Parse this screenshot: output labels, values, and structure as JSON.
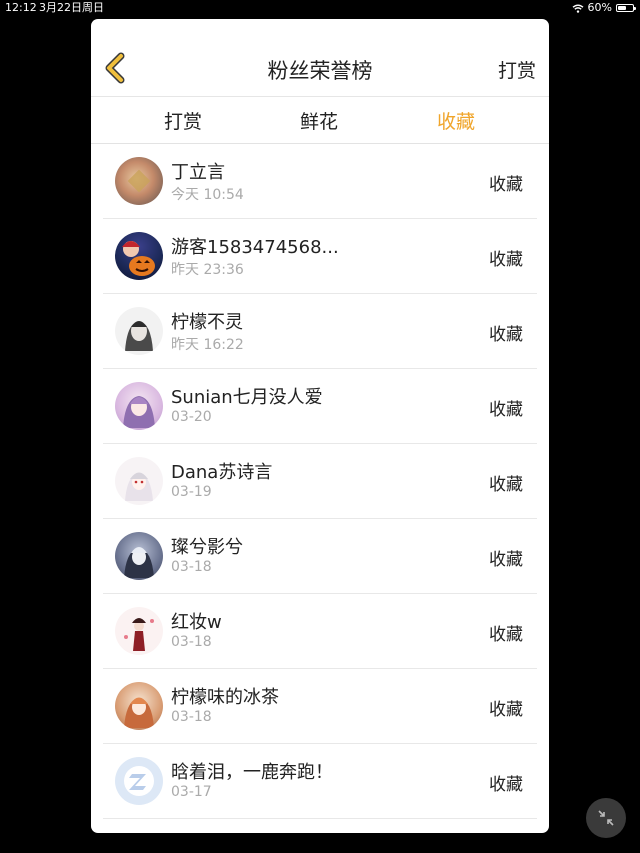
{
  "status_bar": {
    "time": "12:12",
    "date": "3月22日周日",
    "battery": "60%",
    "battery_level": 0.6
  },
  "header": {
    "title": "粉丝荣誉榜",
    "right_action": "打赏"
  },
  "tabs": [
    {
      "label": "打赏",
      "active": false
    },
    {
      "label": "鲜花",
      "active": false
    },
    {
      "label": "收藏",
      "active": true
    }
  ],
  "rows": [
    {
      "name": "丁立言",
      "time": "今天 10:54",
      "action": "收藏"
    },
    {
      "name": "游客1583474568...",
      "time": "昨天 23:36",
      "action": "收藏"
    },
    {
      "name": "柠檬不灵",
      "time": "昨天 16:22",
      "action": "收藏"
    },
    {
      "name": "Sunian七月没人爱",
      "time": "03-20",
      "action": "收藏"
    },
    {
      "name": "Dana苏诗言",
      "time": "03-19",
      "action": "收藏"
    },
    {
      "name": "璨兮影兮",
      "time": "03-18",
      "action": "收藏"
    },
    {
      "name": "红妆w",
      "time": "03-18",
      "action": "收藏"
    },
    {
      "name": "柠檬味的冰茶",
      "time": "03-18",
      "action": "收藏"
    },
    {
      "name": "晗着泪，一鹿奔跑！",
      "time": "03-17",
      "action": "收藏"
    }
  ],
  "colors": {
    "accent": "#f0a52b",
    "text": "#222222",
    "muted": "#aaaaaa",
    "background": "#000000"
  },
  "icons": {
    "back": "chevron-left-icon",
    "float": "collapse-arrows-icon",
    "default_avatar": "qq-logo-icon"
  }
}
